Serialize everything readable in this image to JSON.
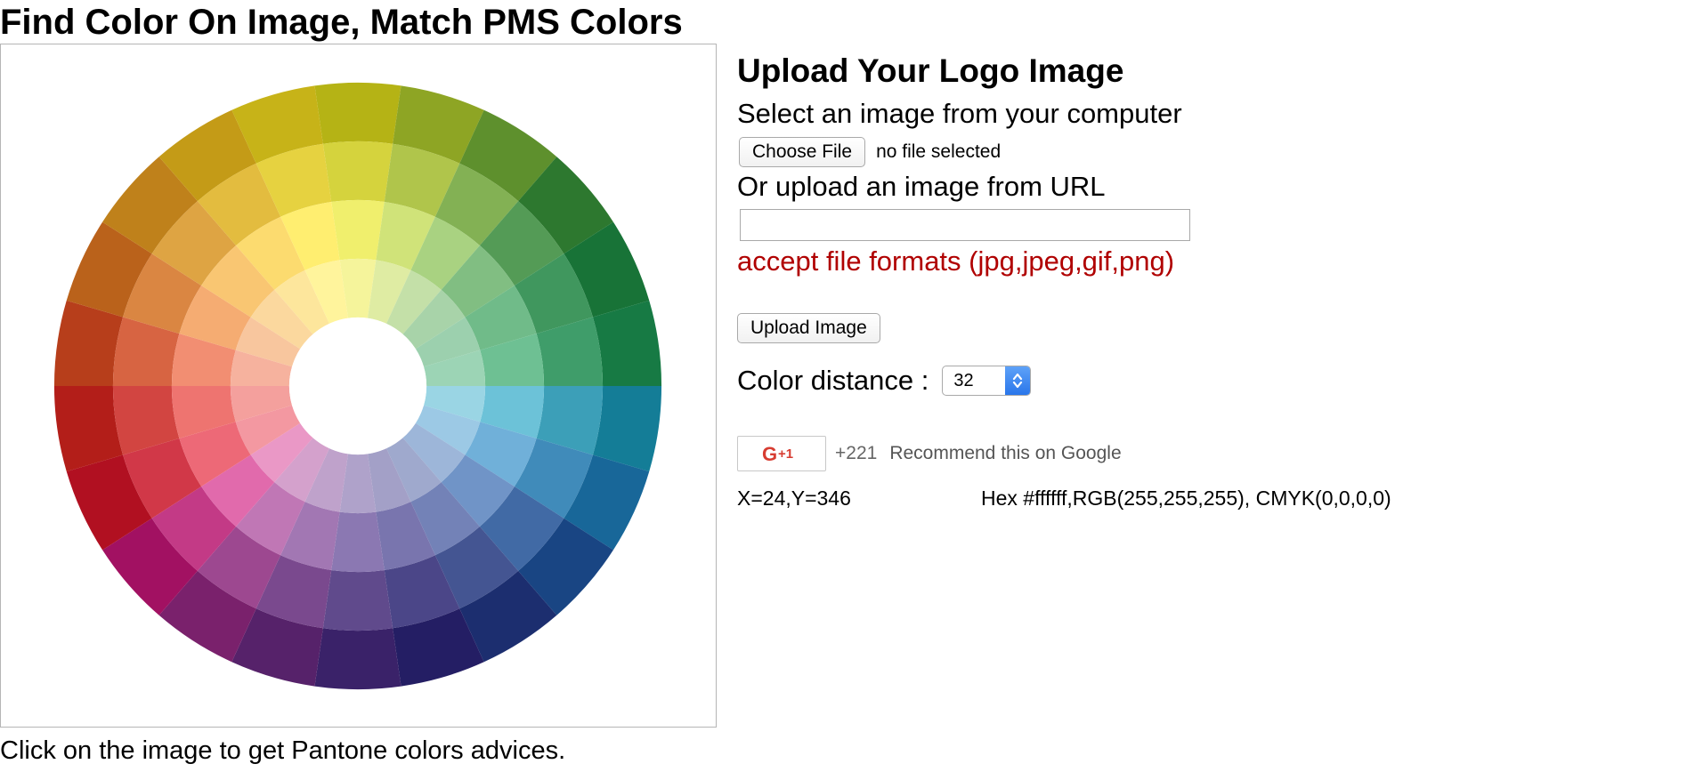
{
  "page": {
    "title": "Find Color On Image, Match PMS Colors",
    "caption": "Click on the image to get Pantone colors advices."
  },
  "upload": {
    "heading": "Upload Your Logo Image",
    "select_label": "Select an image from your computer",
    "choose_file_label": "Choose File",
    "no_file_text": "no file selected",
    "url_label": "Or upload an image from URL",
    "url_value": "",
    "formats_text": "accept file formats (jpg,jpeg,gif,png)",
    "upload_button_label": "Upload Image"
  },
  "distance": {
    "label": "Color distance :",
    "selected": "32"
  },
  "gplus": {
    "button_label": "G+1",
    "count": "+221",
    "text": "Recommend this on Google"
  },
  "readout": {
    "coords": "X=24,Y=346",
    "color": "Hex #ffffff,RGB(255,255,255), CMYK(0,0,0,0)"
  },
  "colors": {
    "format_text": "#b00000",
    "gplus_red": "#d73d32",
    "select_accent": "#2a76ea"
  },
  "icons": {
    "select_arrows": "updown-chevron-icon",
    "gplus": "google-plus-icon"
  },
  "color_wheel": {
    "hues": [
      "#e8e61b",
      "#b6d32e",
      "#79b83a",
      "#3a9a3c",
      "#1f9447",
      "#1d9d57",
      "#19a0c2",
      "#1f84c4",
      "#2058a8",
      "#243b8e",
      "#2e2780",
      "#4a2c86",
      "#6e2b88",
      "#9d2a8b",
      "#d0167e",
      "#e3142a",
      "#e52620",
      "#eb4f22",
      "#ef7d22",
      "#f5a623",
      "#fbc71e",
      "#ffe51f"
    ],
    "ring_tint": [
      0.0,
      0.18,
      0.36,
      0.56
    ],
    "ring_shade": [
      0.22,
      0.1,
      0.0,
      0.0
    ]
  }
}
